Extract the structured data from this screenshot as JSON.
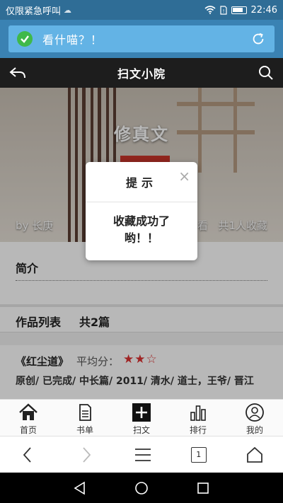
{
  "status_bar": {
    "carrier": "仅限紧急呼叫",
    "time": "22:46"
  },
  "browser": {
    "address_text": "看什喵？！"
  },
  "header": {
    "title": "扫文小院"
  },
  "hero": {
    "book_title": "修真文",
    "author": "by 长庚",
    "favorites_partial": "看",
    "favorites": "共1人收藏"
  },
  "intro": {
    "label": "简介"
  },
  "works": {
    "label": "作品列表",
    "count": "共2篇",
    "items": [
      {
        "title": "《红尘道》",
        "score_label": "平均分：",
        "rating": 2,
        "rating_max": 3,
        "stars_filled": "★★",
        "stars_empty": "☆",
        "tags": "原创/ 已完成/ 中长篇/ 2011/ 清水/ 道士，王爷/ 晋江"
      }
    ]
  },
  "tabbar": {
    "items": [
      {
        "label": "首页",
        "icon": "home-icon"
      },
      {
        "label": "书单",
        "icon": "booklist-icon"
      },
      {
        "label": "扫文",
        "icon": "add-icon"
      },
      {
        "label": "排行",
        "icon": "ranking-icon"
      },
      {
        "label": "我的",
        "icon": "profile-icon"
      }
    ]
  },
  "browser_bar": {
    "tab_count": "1"
  },
  "modal": {
    "title": "提示",
    "close": "×",
    "message": "收藏成功了哟！！"
  }
}
